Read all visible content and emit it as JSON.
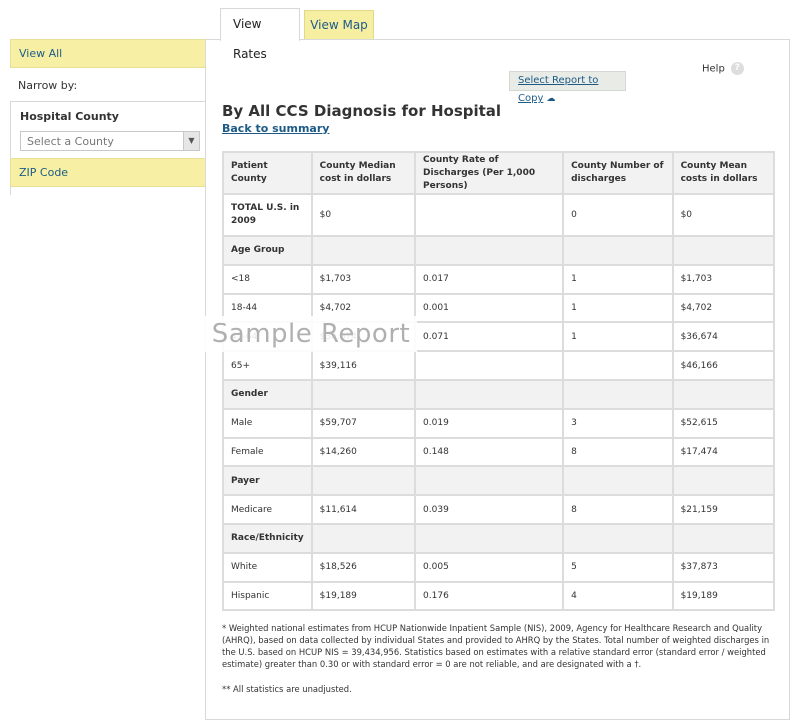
{
  "tabs": {
    "active": "View Rates",
    "inactive": "View Map"
  },
  "sidebar": {
    "view_all": "View All",
    "narrow_by": "Narrow by:",
    "filter_label": "Hospital County",
    "county_placeholder": "Select a County",
    "zip_code": "ZIP Code"
  },
  "panel": {
    "help": "Help",
    "help_icon": "question-icon",
    "copy_button": "Select Report to Copy",
    "copy_icon": "cloud-upload-icon",
    "title": "By All CCS Diagnosis for Hospital",
    "back_link": "Back to summary",
    "watermark": "Sample Report"
  },
  "table": {
    "headers": [
      "Patient County",
      "County Median cost in dollars",
      "County Rate of Discharges (Per 1,000 Persons)",
      "County Number of discharges",
      "County Mean costs in dollars"
    ],
    "rows": [
      {
        "type": "total",
        "cells": [
          "TOTAL U.S. in 2009",
          "$0",
          "",
          "0",
          "$0"
        ]
      },
      {
        "type": "group",
        "cells": [
          "Age Group",
          "",
          "",
          "",
          ""
        ]
      },
      {
        "type": "data",
        "cells": [
          "<18",
          "$1,703",
          "0.017",
          "1",
          "$1,703"
        ]
      },
      {
        "type": "data",
        "cells": [
          "18-44",
          "$4,702",
          "0.001",
          "1",
          "$4,702"
        ]
      },
      {
        "type": "data",
        "cells": [
          "45-64",
          "$36,674",
          "0.071",
          "1",
          "$36,674"
        ]
      },
      {
        "type": "data",
        "cells": [
          "65+",
          "$39,116",
          "",
          "",
          "$46,166"
        ]
      },
      {
        "type": "group",
        "cells": [
          "Gender",
          "",
          "",
          "",
          ""
        ]
      },
      {
        "type": "data",
        "cells": [
          "Male",
          "$59,707",
          "0.019",
          "3",
          "$52,615"
        ]
      },
      {
        "type": "data",
        "cells": [
          "Female",
          "$14,260",
          "0.148",
          "8",
          "$17,474"
        ]
      },
      {
        "type": "group",
        "cells": [
          "Payer",
          "",
          "",
          "",
          ""
        ]
      },
      {
        "type": "data",
        "cells": [
          "Medicare",
          "$11,614",
          "0.039",
          "8",
          "$21,159"
        ]
      },
      {
        "type": "group",
        "cells": [
          "Race/Ethnicity",
          "",
          "",
          "",
          ""
        ]
      },
      {
        "type": "data",
        "cells": [
          "White",
          "$18,526",
          "0.005",
          "5",
          "$37,873"
        ]
      },
      {
        "type": "data",
        "cells": [
          "Hispanic",
          "$19,189",
          "0.176",
          "4",
          "$19,189"
        ]
      }
    ]
  },
  "footnotes": {
    "note1": "* Weighted national estimates from HCUP Nationwide Inpatient Sample (NIS), 2009, Agency for Healthcare Research and Quality (AHRQ), based on data collected by individual States and provided to AHRQ by the States. Total number of weighted discharges in the U.S. based on HCUP NIS = 39,434,956. Statistics based on estimates with a relative standard error (standard error / weighted estimate) greater than 0.30 or with standard error = 0 are not reliable, and are designated with a †.",
    "note2": "** All statistics are unadjusted."
  }
}
